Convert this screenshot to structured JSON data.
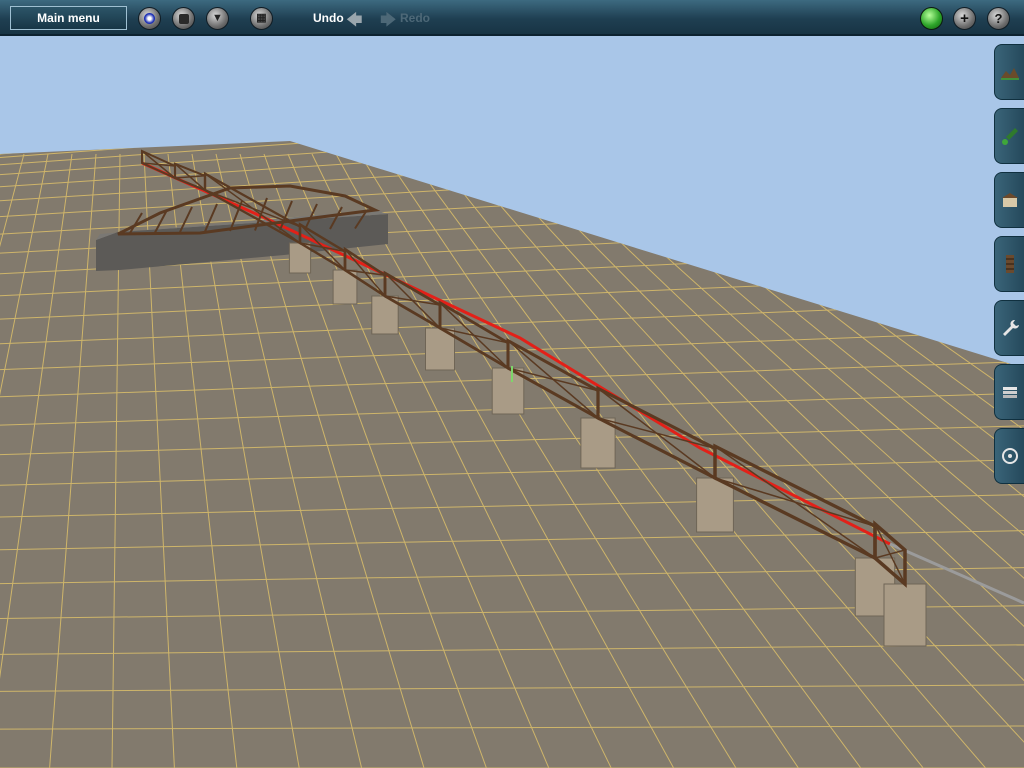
{
  "toolbar": {
    "main_menu_label": "Main menu",
    "undo_label": "Undo",
    "redo_label": "Redo",
    "left_buttons": [
      {
        "name": "driver-mode-button",
        "icon": "compass-icon"
      },
      {
        "name": "stop-button",
        "icon": "stop-icon"
      },
      {
        "name": "filter-button",
        "icon": "funnel-icon"
      },
      {
        "name": "grid-button",
        "icon": "grid-icon"
      }
    ],
    "right_buttons": [
      {
        "name": "status-indicator",
        "icon": "green-light-icon"
      },
      {
        "name": "add-button",
        "icon": "plus-icon"
      },
      {
        "name": "help-button",
        "icon": "question-icon"
      }
    ]
  },
  "side_tabs": [
    {
      "name": "topology-tab",
      "icon": "terrain-icon"
    },
    {
      "name": "paint-tab",
      "icon": "paint-brush-icon"
    },
    {
      "name": "objects-tab",
      "icon": "building-icon"
    },
    {
      "name": "track-tab",
      "icon": "track-icon"
    },
    {
      "name": "tools-tab",
      "icon": "wrench-icon"
    },
    {
      "name": "layers-tab",
      "icon": "layers-icon"
    },
    {
      "name": "settings-tab",
      "icon": "gear-icon"
    }
  ],
  "colors": {
    "sky": "#a9c6e8",
    "ground": "#827a6d",
    "grid": "#e8c96a",
    "bridge": "#5a3a22",
    "track_highlight": "#e32018"
  }
}
